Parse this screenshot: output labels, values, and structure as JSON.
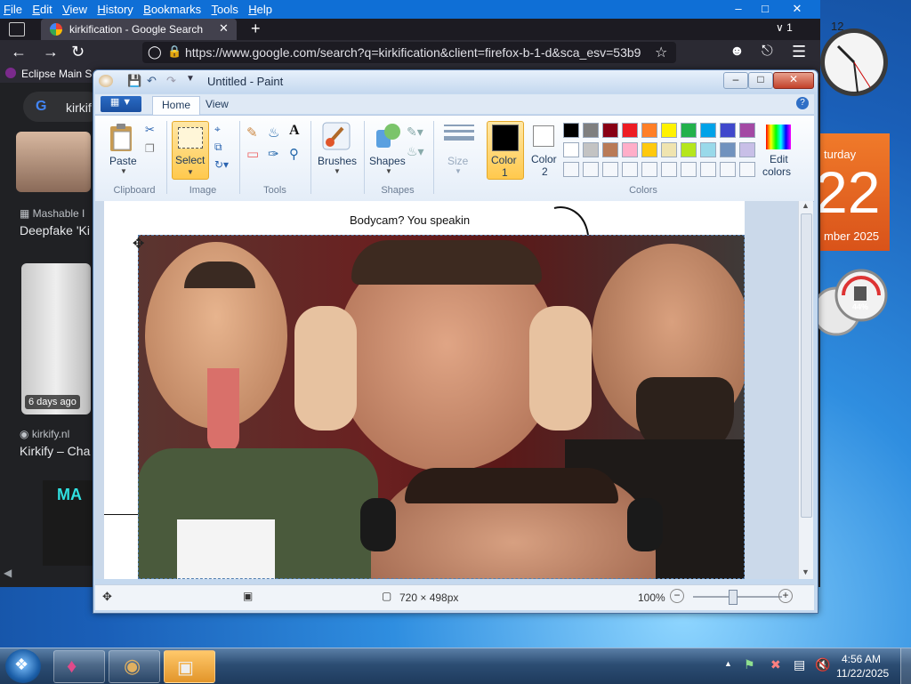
{
  "firefox": {
    "menubar": [
      {
        "label": "File",
        "ul": "F",
        "rest": "ile"
      },
      {
        "label": "Edit",
        "ul": "E",
        "rest": "dit"
      },
      {
        "label": "View",
        "ul": "V",
        "rest": "iew"
      },
      {
        "label": "History",
        "ul": "H",
        "rest": "istory"
      },
      {
        "label": "Bookmarks",
        "ul": "B",
        "rest": "ookmarks"
      },
      {
        "label": "Tools",
        "ul": "T",
        "rest": "ools"
      },
      {
        "label": "Help",
        "ul": "H",
        "rest": "elp"
      }
    ],
    "tab_title": "kirkification - Google Search",
    "tab_count": "1",
    "url": "https://www.google.com/search?q=kirkification&client=firefox-b-1-d&sca_esv=53b9",
    "bookmark": "Eclipse Main S",
    "search_query": "kirkif",
    "results": {
      "mashable_source": "Mashable I",
      "mashable_title": "Deepfake 'Ki",
      "time_badge": "6 days ago",
      "kirkify_source": "kirkify.nl",
      "kirkify_title": "Kirkify – Cha",
      "thumb_text": "MA"
    }
  },
  "gadgets": {
    "calendar_day_name": "turday",
    "calendar_day": "22",
    "calendar_month": "mber 2025",
    "meter_percent": "44%"
  },
  "paint": {
    "title": "Untitled - Paint",
    "tabs": {
      "home": "Home",
      "view": "View"
    },
    "groups": {
      "clipboard": "Clipboard",
      "image": "Image",
      "tools": "Tools",
      "shapes": "Shapes",
      "colors": "Colors"
    },
    "buttons": {
      "paste": "Paste",
      "select": "Select",
      "brushes": "Brushes",
      "shapes": "Shapes",
      "size": "Size",
      "color1": "Color",
      "color1_num": "1",
      "color2": "Color",
      "color2_num": "2",
      "edit_colors_1": "Edit",
      "edit_colors_2": "colors"
    },
    "palette_row1": [
      "#000000",
      "#7f7f7f",
      "#880015",
      "#ed1c24",
      "#ff7f27",
      "#fff200",
      "#22b14c",
      "#00a2e8",
      "#3f48cc",
      "#a349a4"
    ],
    "palette_row2": [
      "#ffffff",
      "#c3c3c3",
      "#b97a57",
      "#ffaec9",
      "#ffc90e",
      "#efe4b0",
      "#b5e61d",
      "#99d9ea",
      "#7092be",
      "#c8bfe7"
    ],
    "color1_value": "#000000",
    "color2_value": "#ffffff",
    "canvas_text_1": "Bodycam? You speakin",
    "canvas_text_2": "...",
    "status_size": "720 × 498px",
    "zoom": "100%"
  },
  "taskbar": {
    "time": "4:56 AM",
    "date": "11/22/2025"
  }
}
